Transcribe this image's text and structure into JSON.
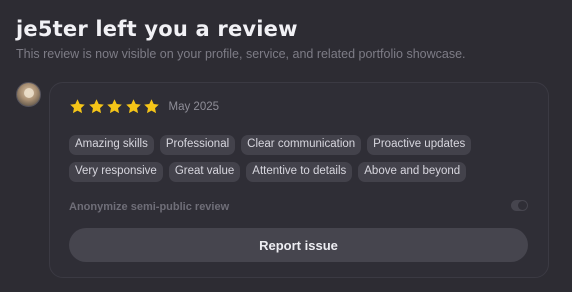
{
  "header": {
    "title": "je5ter left you a review",
    "subtitle": "This review is now visible on your profile, service, and related portfolio showcase."
  },
  "review": {
    "rating": 5,
    "max_rating": 5,
    "star_color": "#f5c518",
    "date": "May 2025",
    "tags": [
      "Amazing skills",
      "Professional",
      "Clear communication",
      "Proactive updates",
      "Very responsive",
      "Great value",
      "Attentive to details",
      "Above and beyond"
    ],
    "anonymize_label": "Anonymize semi-public review",
    "anonymize_enabled": false,
    "report_button": "Report issue"
  }
}
